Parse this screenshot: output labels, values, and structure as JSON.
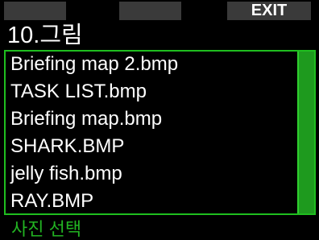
{
  "softkeys": {
    "left": "",
    "middle": "",
    "right": "EXIT"
  },
  "title": "10.그림",
  "files": [
    "Briefing map 2.bmp",
    "TASK LIST.bmp",
    "Briefing map.bmp",
    "SHARK.BMP",
    "jelly fish.bmp",
    "RAY.BMP"
  ],
  "hint": "사진 선택",
  "colors": {
    "accent": "#1fbe1f",
    "softkey_bg": "#3a3a3a",
    "background": "#000000",
    "hint_text": "#22b322"
  }
}
